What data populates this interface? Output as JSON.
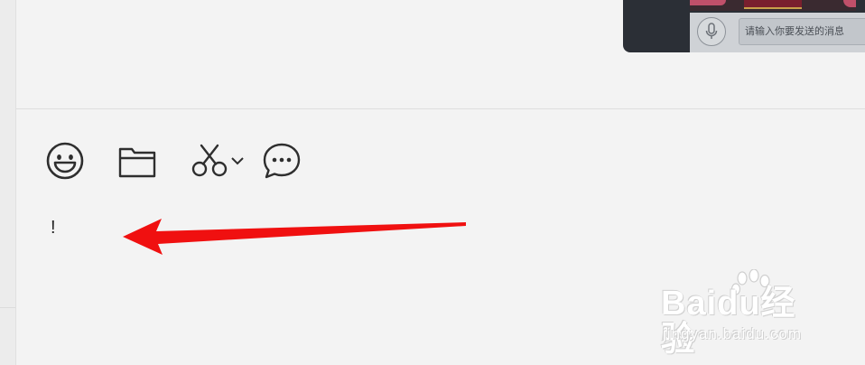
{
  "phone_screenshot": {
    "input_placeholder": "请输入你要发送的消息"
  },
  "toolbar": {
    "tools": [
      {
        "icon": "emoji-icon"
      },
      {
        "icon": "folder-icon"
      },
      {
        "icon": "scissors-icon"
      },
      {
        "icon": "chevron-down-icon"
      },
      {
        "icon": "chat-bubble-icon"
      }
    ]
  },
  "composer": {
    "text": "!"
  },
  "annotation": {
    "color": "#f01010"
  },
  "watermark": {
    "brand": "Baidu经验",
    "url": "jingyan.baidu.com"
  }
}
